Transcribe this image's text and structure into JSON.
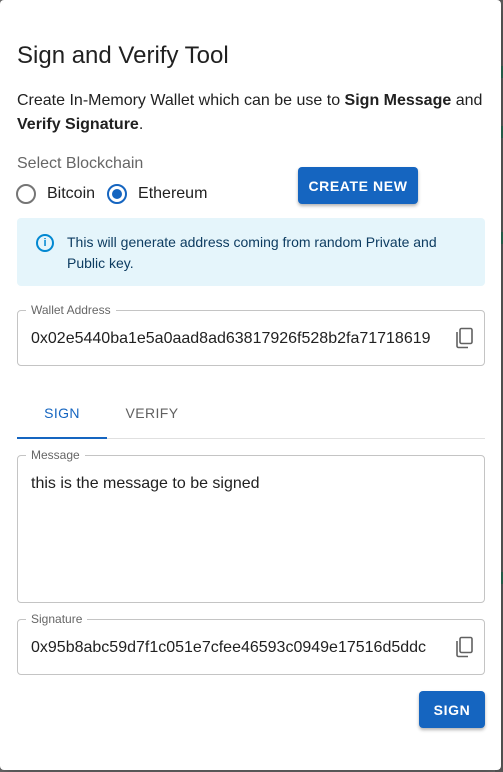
{
  "dialog": {
    "title": "Sign and Verify Tool",
    "description": {
      "part1": "Create In-Memory Wallet which can be use to ",
      "bold1": "Sign Message",
      "part2": " and ",
      "bold2": "Verify Signature",
      "part3": "."
    }
  },
  "blockchain": {
    "label": "Select Blockchain",
    "options": [
      {
        "label": "Bitcoin",
        "selected": false
      },
      {
        "label": "Ethereum",
        "selected": true
      }
    ]
  },
  "create_button": "CREATE NEW",
  "info_alert": {
    "icon": "info-icon",
    "text": "This will generate address coming from random Private and Public key."
  },
  "wallet": {
    "label": "Wallet Address",
    "value": "0x02e5440ba1e5a0aad8ad63817926f528b2fa71718619"
  },
  "tabs": [
    {
      "label": "SIGN",
      "active": true
    },
    {
      "label": "VERIFY",
      "active": false
    }
  ],
  "message": {
    "label": "Message",
    "value": "this is the message to be signed"
  },
  "signature": {
    "label": "Signature",
    "value": "0x95b8abc59d7f1c051e7cfee46593c0949e17516d5ddc"
  },
  "sign_button": "SIGN",
  "colors": {
    "primary": "#1565c0",
    "info_bg": "#e5f5fb",
    "info_icon": "#0288d1"
  }
}
